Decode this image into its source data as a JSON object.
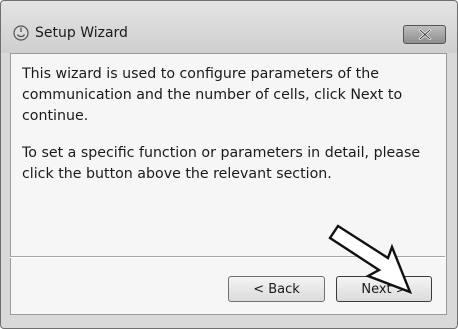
{
  "window": {
    "title": "Setup Wizard",
    "app_icon": "wizard-app-icon",
    "close_icon": "close-icon"
  },
  "content": {
    "paragraph1": "This wizard is used to configure parameters of the communication and the number of cells, click Next to continue.",
    "paragraph2": "To set a specific function or parameters in detail, please click the button above the relevant section."
  },
  "buttons": {
    "back_label": "< Back",
    "next_label": "Next >"
  },
  "annotation": {
    "icon": "pointer-arrow-icon",
    "target": "Next >"
  }
}
